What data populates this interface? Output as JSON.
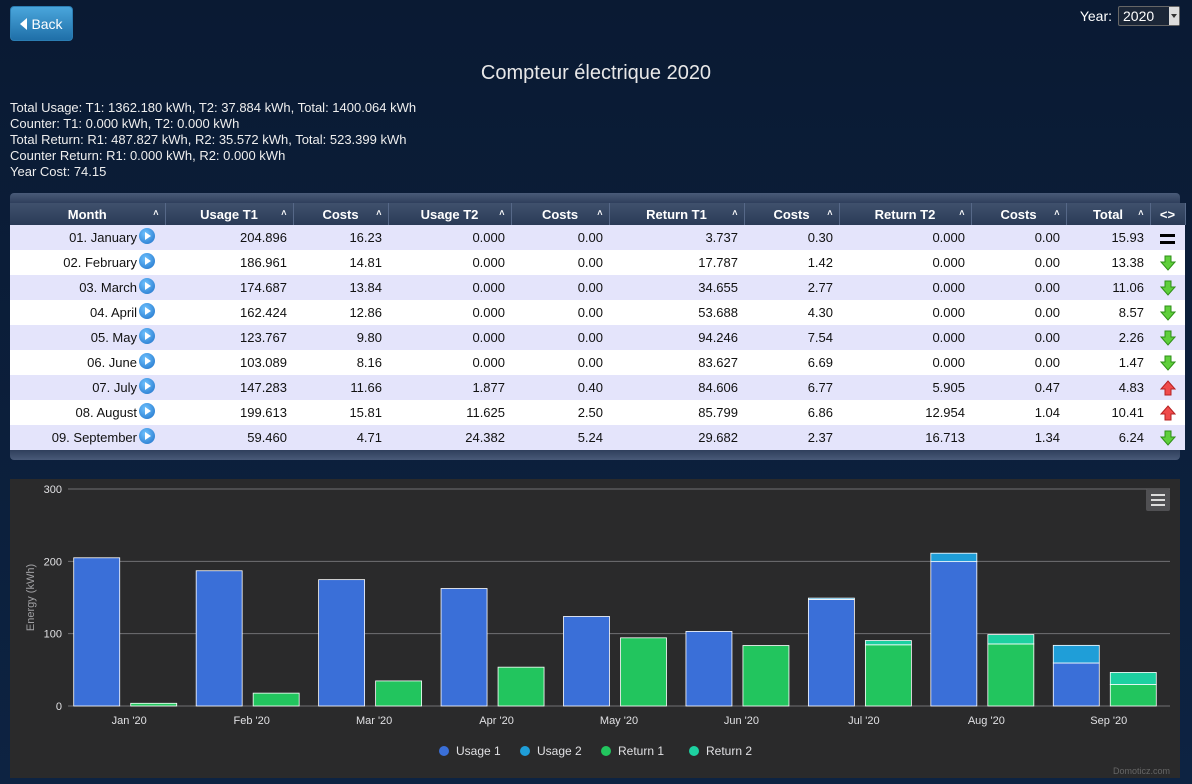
{
  "back_label": "Back",
  "year": {
    "label": "Year:",
    "value": "2020"
  },
  "title": "Compteur électrique 2020",
  "summary": [
    "Total Usage: T1: 1362.180 kWh, T2: 37.884 kWh, Total: 1400.064 kWh",
    "Counter: T1: 0.000 kWh, T2: 0.000 kWh",
    "Total Return: R1: 487.827 kWh, R2: 35.572 kWh, Total: 523.399 kWh",
    "Counter Return: R1: 0.000 kWh, R2: 0.000 kWh",
    "Year Cost: 74.15"
  ],
  "table": {
    "headers": [
      "Month",
      "Usage T1",
      "Costs",
      "Usage T2",
      "Costs",
      "Return T1",
      "Costs",
      "Return T2",
      "Costs",
      "Total",
      "<>"
    ],
    "rows": [
      {
        "month": "01. January",
        "u1": "204.896",
        "c1": "16.23",
        "u2": "0.000",
        "c2": "0.00",
        "r1": "3.737",
        "c3": "0.30",
        "r2": "0.000",
        "c4": "0.00",
        "total": "15.93",
        "trend": "equal"
      },
      {
        "month": "02. February",
        "u1": "186.961",
        "c1": "14.81",
        "u2": "0.000",
        "c2": "0.00",
        "r1": "17.787",
        "c3": "1.42",
        "r2": "0.000",
        "c4": "0.00",
        "total": "13.38",
        "trend": "down"
      },
      {
        "month": "03. March",
        "u1": "174.687",
        "c1": "13.84",
        "u2": "0.000",
        "c2": "0.00",
        "r1": "34.655",
        "c3": "2.77",
        "r2": "0.000",
        "c4": "0.00",
        "total": "11.06",
        "trend": "down"
      },
      {
        "month": "04. April",
        "u1": "162.424",
        "c1": "12.86",
        "u2": "0.000",
        "c2": "0.00",
        "r1": "53.688",
        "c3": "4.30",
        "r2": "0.000",
        "c4": "0.00",
        "total": "8.57",
        "trend": "down"
      },
      {
        "month": "05. May",
        "u1": "123.767",
        "c1": "9.80",
        "u2": "0.000",
        "c2": "0.00",
        "r1": "94.246",
        "c3": "7.54",
        "r2": "0.000",
        "c4": "0.00",
        "total": "2.26",
        "trend": "down"
      },
      {
        "month": "06. June",
        "u1": "103.089",
        "c1": "8.16",
        "u2": "0.000",
        "c2": "0.00",
        "r1": "83.627",
        "c3": "6.69",
        "r2": "0.000",
        "c4": "0.00",
        "total": "1.47",
        "trend": "down"
      },
      {
        "month": "07. July",
        "u1": "147.283",
        "c1": "11.66",
        "u2": "1.877",
        "c2": "0.40",
        "r1": "84.606",
        "c3": "6.77",
        "r2": "5.905",
        "c4": "0.47",
        "total": "4.83",
        "trend": "up"
      },
      {
        "month": "08. August",
        "u1": "199.613",
        "c1": "15.81",
        "u2": "11.625",
        "c2": "2.50",
        "r1": "85.799",
        "c3": "6.86",
        "r2": "12.954",
        "c4": "1.04",
        "total": "10.41",
        "trend": "up"
      },
      {
        "month": "09. September",
        "u1": "59.460",
        "c1": "4.71",
        "u2": "24.382",
        "c2": "5.24",
        "r1": "29.682",
        "c3": "2.37",
        "r2": "16.713",
        "c4": "1.34",
        "total": "6.24",
        "trend": "down"
      }
    ]
  },
  "credit": "Domoticz.com",
  "chart_data": {
    "type": "bar",
    "stacked": true,
    "categories": [
      "Jan '20",
      "Feb '20",
      "Mar '20",
      "Apr '20",
      "May '20",
      "Jun '20",
      "Jul '20",
      "Aug '20",
      "Sep '20"
    ],
    "ylabel": "Energy (kWh)",
    "ylim": [
      0,
      300
    ],
    "yticks": [
      0,
      100,
      200,
      300
    ],
    "stacks": [
      {
        "stack": "usage",
        "series": [
          {
            "name": "Usage 1",
            "color": "#3a6fd8",
            "values": [
              204.896,
              186.961,
              174.687,
              162.424,
              123.767,
              103.089,
              147.283,
              199.613,
              59.46
            ]
          },
          {
            "name": "Usage 2",
            "color": "#1f9ed8",
            "values": [
              0,
              0,
              0,
              0,
              0,
              0,
              1.877,
              11.625,
              24.382
            ]
          }
        ]
      },
      {
        "stack": "return",
        "series": [
          {
            "name": "Return 1",
            "color": "#22c55e",
            "values": [
              3.737,
              17.787,
              34.655,
              53.688,
              94.246,
              83.627,
              84.606,
              85.799,
              29.682
            ]
          },
          {
            "name": "Return 2",
            "color": "#1dd1a1",
            "values": [
              0,
              0,
              0,
              0,
              0,
              0,
              5.905,
              12.954,
              16.713
            ]
          }
        ]
      }
    ],
    "legend": [
      "Usage 1",
      "Usage 2",
      "Return 1",
      "Return 2"
    ],
    "grid": true
  }
}
